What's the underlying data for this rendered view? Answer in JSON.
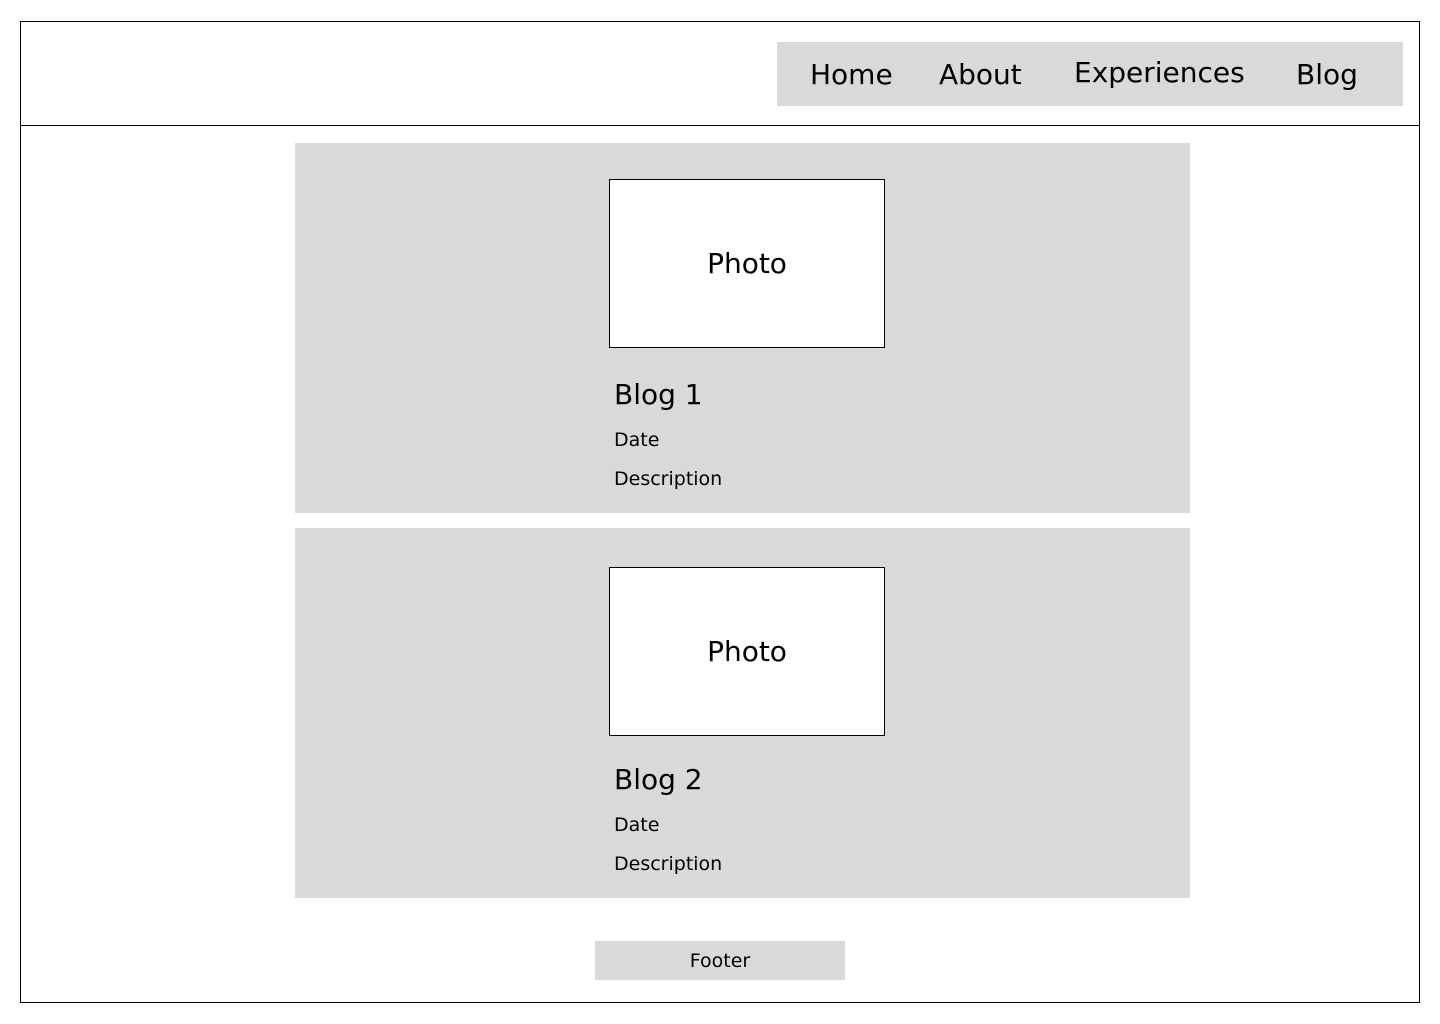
{
  "nav": {
    "items": [
      {
        "label": "Home"
      },
      {
        "label": "About"
      },
      {
        "label": "Experiences"
      },
      {
        "label": "Blog"
      }
    ]
  },
  "blogs": [
    {
      "photo_label": "Photo",
      "title": "Blog 1",
      "date": "Date",
      "description": "Description"
    },
    {
      "photo_label": "Photo",
      "title": "Blog 2",
      "date": "Date",
      "description": "Description"
    }
  ],
  "footer": {
    "label": "Footer"
  },
  "colors": {
    "panel": "#d9d9d9",
    "background": "#ffffff",
    "border": "#000000"
  }
}
